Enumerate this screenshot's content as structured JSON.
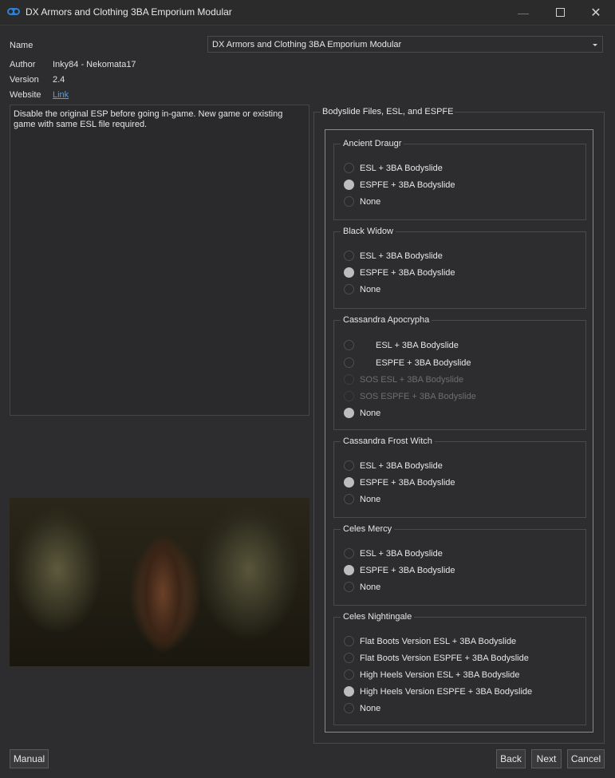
{
  "window": {
    "title": "DX Armors and Clothing 3BA Emporium Modular"
  },
  "info": {
    "name_label": "Name",
    "name_value": "DX Armors and Clothing 3BA Emporium Modular",
    "author_label": "Author",
    "author_value": "Inky84 - Nekomata17",
    "version_label": "Version",
    "version_value": "2.4",
    "website_label": "Website",
    "website_link": "Link"
  },
  "description": "Disable the original ESP before going in-game. New game or existing game with same ESL file required.",
  "options_panel": {
    "title": "Bodyslide Files, ESL, and ESPFE",
    "groups": [
      {
        "title": "Ancient Draugr",
        "options": [
          {
            "label": "ESL + 3BA Bodyslide",
            "checked": false
          },
          {
            "label": "ESPFE + 3BA Bodyslide",
            "checked": true
          },
          {
            "label": "None",
            "checked": false
          }
        ]
      },
      {
        "title": "Black Widow",
        "options": [
          {
            "label": "ESL + 3BA Bodyslide",
            "checked": false
          },
          {
            "label": "ESPFE + 3BA Bodyslide",
            "checked": true
          },
          {
            "label": "None",
            "checked": false
          }
        ]
      },
      {
        "title": "Cassandra Apocrypha",
        "options": [
          {
            "label": "ESL + 3BA Bodyslide",
            "checked": false,
            "indent": true
          },
          {
            "label": "ESPFE + 3BA Bodyslide",
            "checked": false,
            "indent": true
          },
          {
            "label": "SOS ESL + 3BA Bodyslide",
            "checked": false,
            "disabled": true
          },
          {
            "label": "SOS ESPFE + 3BA Bodyslide",
            "checked": false,
            "disabled": true
          },
          {
            "label": "None",
            "checked": true
          }
        ]
      },
      {
        "title": "Cassandra Frost Witch",
        "options": [
          {
            "label": "ESL + 3BA Bodyslide",
            "checked": false
          },
          {
            "label": "ESPFE + 3BA Bodyslide",
            "checked": true
          },
          {
            "label": "None",
            "checked": false
          }
        ]
      },
      {
        "title": "Celes Mercy",
        "options": [
          {
            "label": "ESL + 3BA Bodyslide",
            "checked": false
          },
          {
            "label": "ESPFE + 3BA Bodyslide",
            "checked": true
          },
          {
            "label": "None",
            "checked": false
          }
        ]
      },
      {
        "title": "Celes Nightingale",
        "options": [
          {
            "label": "Flat Boots Version ESL + 3BA Bodyslide",
            "checked": false
          },
          {
            "label": "Flat Boots Version ESPFE + 3BA Bodyslide",
            "checked": false
          },
          {
            "label": "High Heels Version ESL + 3BA Bodyslide",
            "checked": false
          },
          {
            "label": "High Heels Version ESPFE + 3BA Bodyslide",
            "checked": true
          },
          {
            "label": "None",
            "checked": false
          }
        ]
      }
    ]
  },
  "buttons": {
    "manual": "Manual",
    "back": "Back",
    "next": "Next",
    "cancel": "Cancel"
  }
}
